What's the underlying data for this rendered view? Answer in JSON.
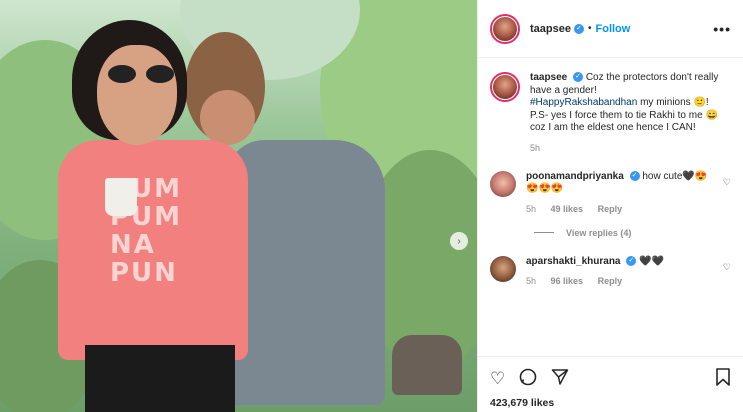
{
  "post": {
    "username": "taapsee",
    "follow_label": "Follow",
    "dot": "•",
    "more_label": "•••",
    "next_label": "›"
  },
  "photo": {
    "shirt_text": "PUM PUM NA PUN"
  },
  "caption": {
    "username": "taapsee",
    "text_1": "Coz the protectors don't really have a gender!",
    "hashtag": "#HappyRakshabandhan",
    "text_2": "my minions 🙂!",
    "text_3": "P.S- yes I force them to tie Rakhi to me 😄 coz I am the eldest one hence I CAN!",
    "time": "5h"
  },
  "comments": [
    {
      "username": "poonamandpriyanka",
      "text": "how cute🖤😍😍😍😍",
      "time": "5h",
      "likes": "49 likes",
      "reply_label": "Reply",
      "view_replies": "View replies (4)"
    },
    {
      "username": "aparshakti_khurana",
      "text": "🖤🖤",
      "time": "5h",
      "likes": "96 likes",
      "reply_label": "Reply"
    }
  ],
  "actions": {
    "like_icon": "heart-icon",
    "comment_icon": "comment-icon",
    "share_icon": "share-icon",
    "save_icon": "bookmark-icon",
    "likes_count": "423,679 likes"
  },
  "colors": {
    "accent": "#0095f6",
    "verified": "#3897f0",
    "story_ring": "#e1306c"
  }
}
